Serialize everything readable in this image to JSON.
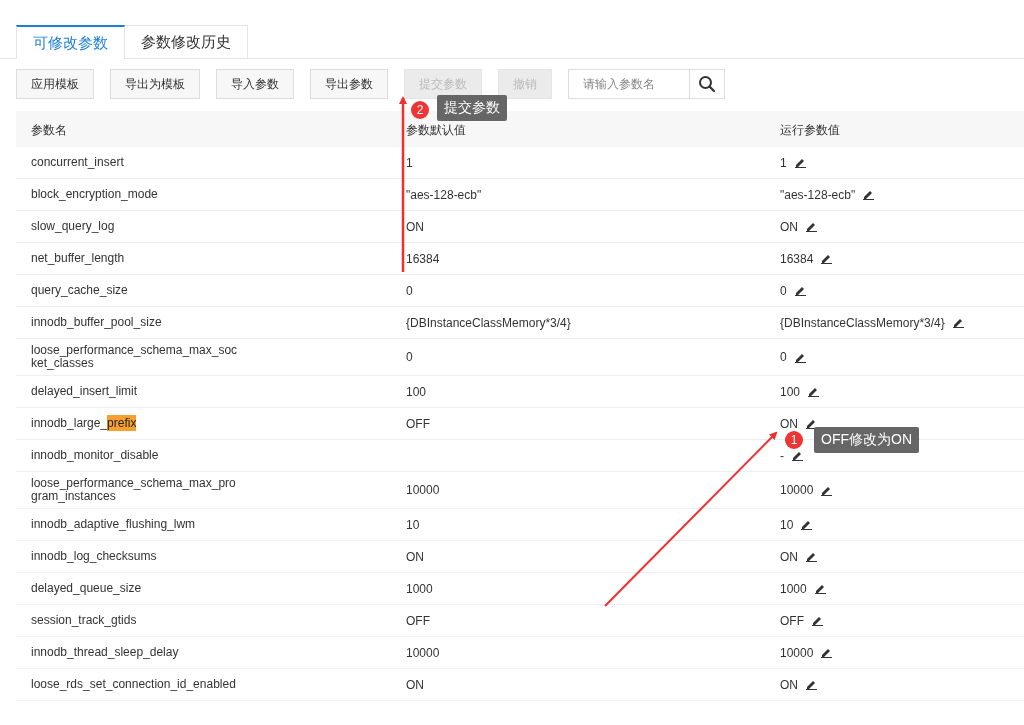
{
  "tabs": [
    {
      "label": "可修改参数",
      "selected": true
    },
    {
      "label": "参数修改历史",
      "selected": false
    }
  ],
  "toolbar": {
    "buttons": [
      {
        "label": "应用模板",
        "disabled": false
      },
      {
        "label": "导出为模板",
        "disabled": false
      },
      {
        "label": "导入参数",
        "disabled": false
      },
      {
        "label": "导出参数",
        "disabled": false
      },
      {
        "label": "提交参数",
        "disabled": true
      },
      {
        "label": "撤销",
        "disabled": true
      }
    ],
    "search": {
      "placeholder": "请输入参数名"
    }
  },
  "table": {
    "columns": [
      "参数名",
      "参数默认值",
      "运行参数值"
    ],
    "rows": [
      {
        "name": "concurrent_insert",
        "default": "1",
        "running": "1"
      },
      {
        "name": "block_encryption_mode",
        "default": "\"aes-128-ecb\"",
        "running": "\"aes-128-ecb\""
      },
      {
        "name": "slow_query_log",
        "default": "ON",
        "running": "ON"
      },
      {
        "name": "net_buffer_length",
        "default": "16384",
        "running": "16384"
      },
      {
        "name": "query_cache_size",
        "default": "0",
        "running": "0"
      },
      {
        "name": "innodb_buffer_pool_size",
        "default": "{DBInstanceClassMemory*3/4}",
        "running": "{DBInstanceClassMemory*3/4}"
      },
      {
        "name": "loose_performance_schema_max_socket_classes",
        "default": "0",
        "running": "0"
      },
      {
        "name": "delayed_insert_limit",
        "default": "100",
        "running": "100"
      },
      {
        "name": "innodb_large_",
        "highlight": "prefix",
        "default": "OFF",
        "running": "ON"
      },
      {
        "name": "innodb_monitor_disable",
        "running": "-"
      },
      {
        "name": "loose_performance_schema_max_program_instances",
        "default": "10000",
        "running": "10000"
      },
      {
        "name": "innodb_adaptive_flushing_lwm",
        "default": "10",
        "running": "10"
      },
      {
        "name": "innodb_log_checksums",
        "default": "ON",
        "running": "ON"
      },
      {
        "name": "delayed_queue_size",
        "default": "1000",
        "running": "1000"
      },
      {
        "name": "session_track_gtids",
        "default": "OFF",
        "running": "OFF"
      },
      {
        "name": "innodb_thread_sleep_delay",
        "default": "10000",
        "running": "10000"
      },
      {
        "name": "loose_rds_set_connection_id_enabled",
        "default": "ON",
        "running": "ON"
      }
    ]
  },
  "annotations": [
    {
      "number": "1",
      "text": "OFF修改为ON"
    },
    {
      "number": "2",
      "text": "提交参数"
    }
  ]
}
